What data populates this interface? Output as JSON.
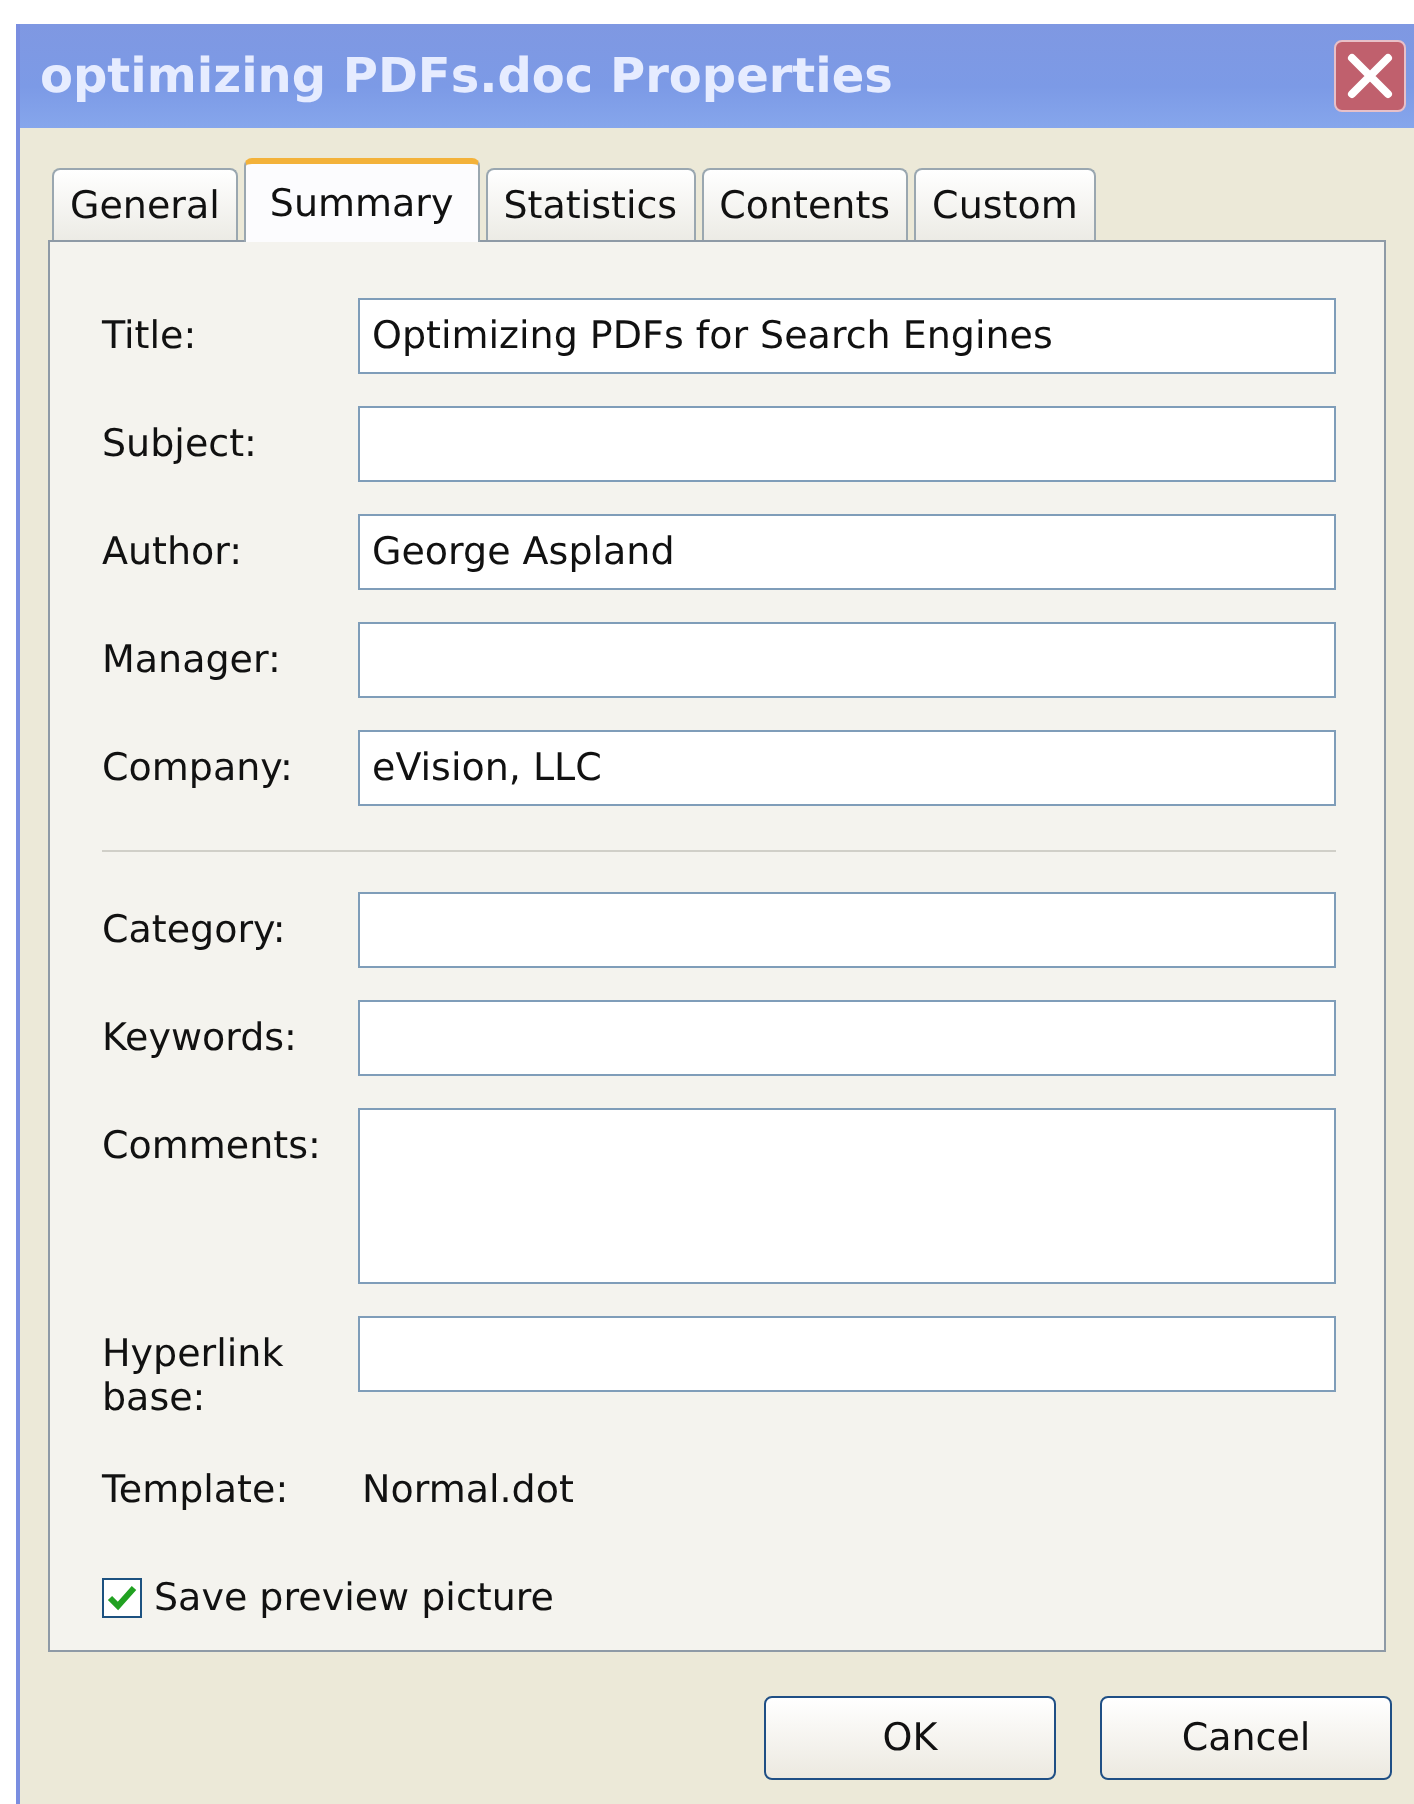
{
  "window": {
    "title": "optimizing PDFs.doc Properties"
  },
  "tabs": [
    {
      "label": "General",
      "selected": false
    },
    {
      "label": "Summary",
      "selected": true
    },
    {
      "label": "Statistics",
      "selected": false
    },
    {
      "label": "Contents",
      "selected": false
    },
    {
      "label": "Custom",
      "selected": false
    }
  ],
  "groups": [
    [
      {
        "label": "Title:",
        "kind": "text",
        "value": "Optimizing PDFs for Search Engines"
      },
      {
        "label": "Subject:",
        "kind": "text"
      },
      {
        "label": "Author:",
        "kind": "text",
        "value": "George Aspland"
      },
      {
        "label": "Manager:",
        "kind": "text"
      },
      {
        "label": "Company:",
        "kind": "text",
        "value": "eVision, LLC"
      }
    ],
    [
      {
        "label": "Category:",
        "kind": "text"
      },
      {
        "label": "Keywords:",
        "kind": "text"
      },
      {
        "label": "Comments:",
        "kind": "multiline"
      },
      {
        "label": "Hyperlink base:",
        "kind": "text"
      },
      {
        "label": "Template:",
        "kind": "readonly",
        "value": "Normal.dot"
      }
    ]
  ],
  "checkbox": {
    "label": "Save preview picture",
    "checked": true
  },
  "buttons": [
    "OK",
    "Cancel"
  ]
}
